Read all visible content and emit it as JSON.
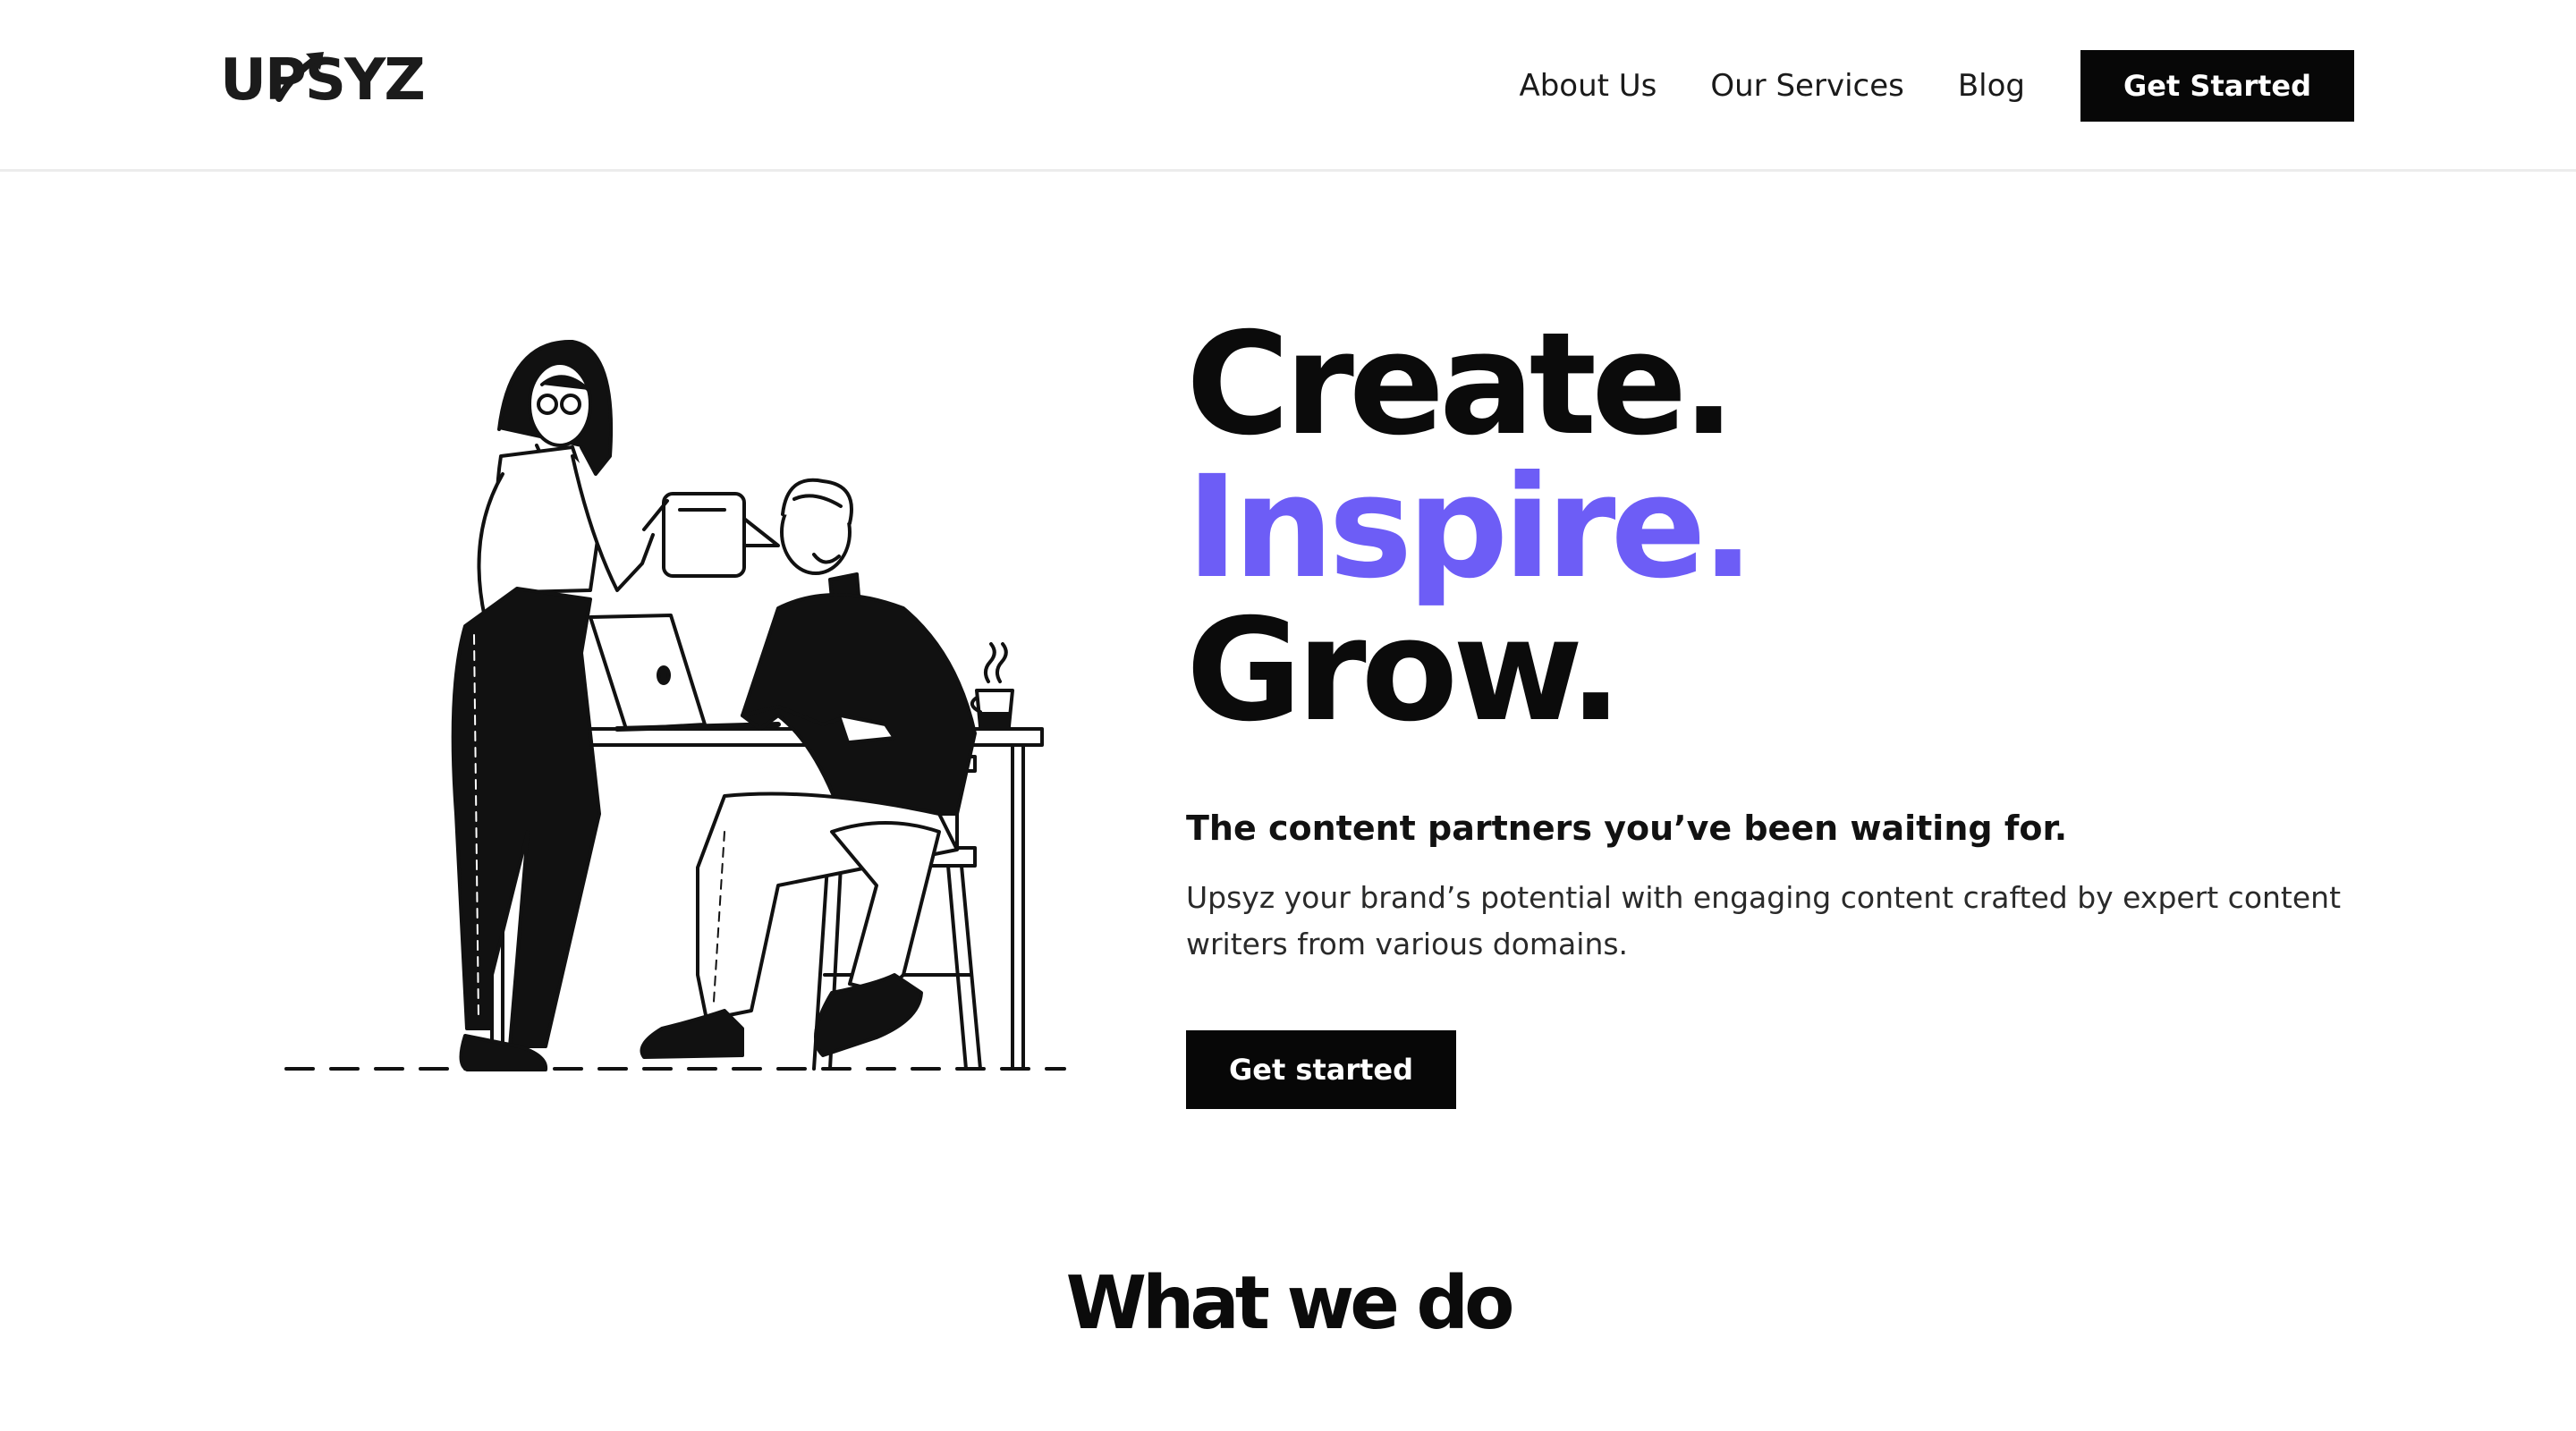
{
  "brand": {
    "logo_text": "UPSYZ"
  },
  "nav": {
    "items": [
      {
        "label": "About Us"
      },
      {
        "label": "Our Services"
      },
      {
        "label": "Blog"
      }
    ],
    "cta_label": "Get Started"
  },
  "hero": {
    "headline_line1": "Create.",
    "headline_line2": "Inspire.",
    "headline_line3": "Grow.",
    "tagline": "The content partners you’ve been waiting for.",
    "description": "Upsyz your brand’s potential with engaging content crafted by expert content writers from various domains.",
    "cta_label": "Get started",
    "illustration": "two-people-working-at-desk-illustration"
  },
  "sections": {
    "what_we_do_title": "What we do"
  },
  "colors": {
    "accent": "#6d5df6",
    "dark": "#070707",
    "background": "#ffffff"
  }
}
